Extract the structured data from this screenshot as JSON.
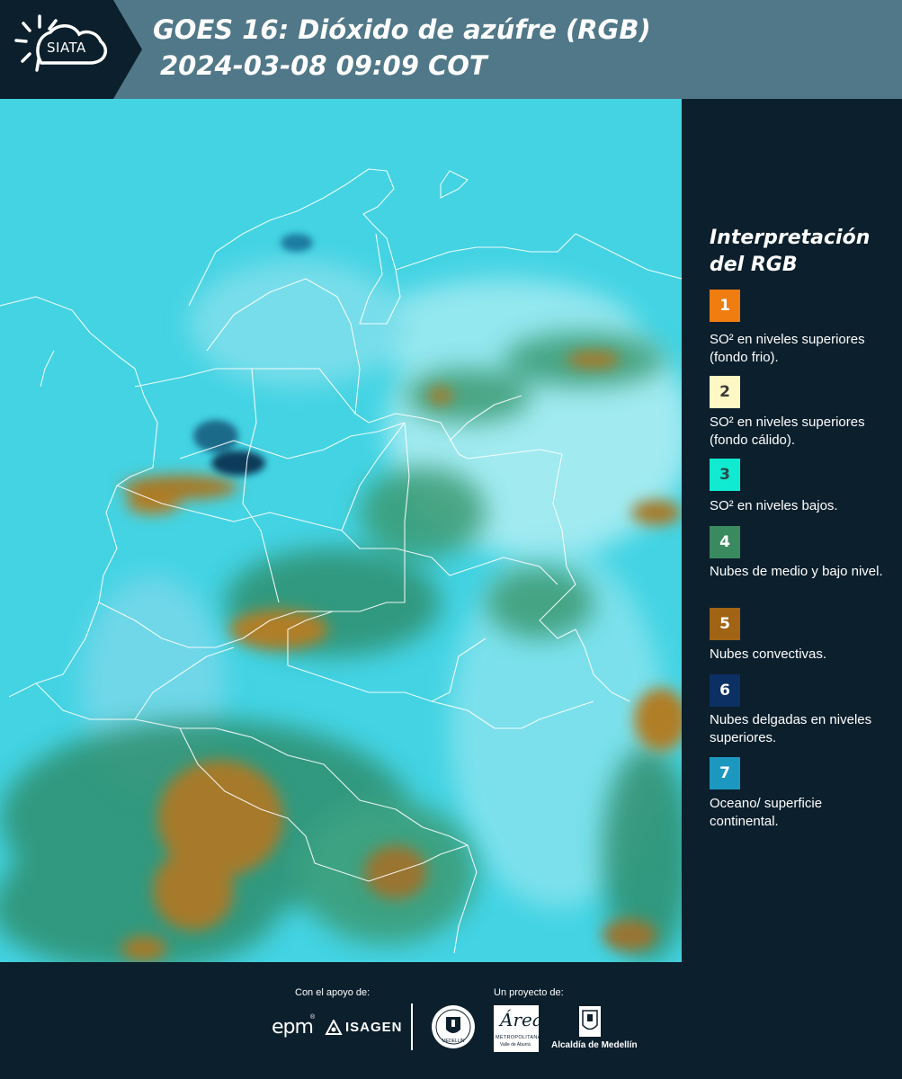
{
  "header": {
    "logo_text": "SIATA",
    "title_line1": "GOES 16: Dióxido de azúfre (RGB)",
    "title_line2": "2024-03-08 09:09 COT",
    "background_color": "#507888"
  },
  "legend": {
    "title": "Interpretación del RGB",
    "items": [
      {
        "number": "1",
        "color": "#f07d10",
        "text_color": "#ffffff",
        "description": "SO² en niveles superiores (fondo frio)."
      },
      {
        "number": "2",
        "color": "#fff8c4",
        "text_color": "#3a3a3a",
        "description": "SO² en niveles superiores (fondo cálido)."
      },
      {
        "number": "3",
        "color": "#10ead0",
        "text_color": "#2a4a4a",
        "description": "SO² en niveles bajos."
      },
      {
        "number": "4",
        "color": "#3a8a60",
        "text_color": "#ffffff",
        "description": "Nubes de medio y bajo nivel."
      },
      {
        "number": "5",
        "color": "#a06414",
        "text_color": "#ffffff",
        "description": "Nubes convectivas."
      },
      {
        "number": "6",
        "color": "#0c3064",
        "text_color": "#ffffff",
        "description": "Nubes delgadas en niveles superiores."
      },
      {
        "number": "7",
        "color": "#1c98c0",
        "text_color": "#ffffff",
        "description": "Oceano/ superficie continental."
      }
    ]
  },
  "footer": {
    "support_label": "Con el apoyo de:",
    "project_label": "Un proyecto de:",
    "sponsors": [
      "epm",
      "ISAGEN"
    ],
    "epm_mark": "®",
    "area_script": "Área",
    "area_line1": "METROPOLITANA",
    "area_line2": "Valle de Aburrá",
    "seal_text": "MEDELLÍN",
    "alcaldia": "Alcaldía de Medellín"
  },
  "colors": {
    "background": "#0c1f2c",
    "map_base": "#43d3e3",
    "convective": "#a67a2a",
    "low_clouds": "#2e8f6e"
  }
}
